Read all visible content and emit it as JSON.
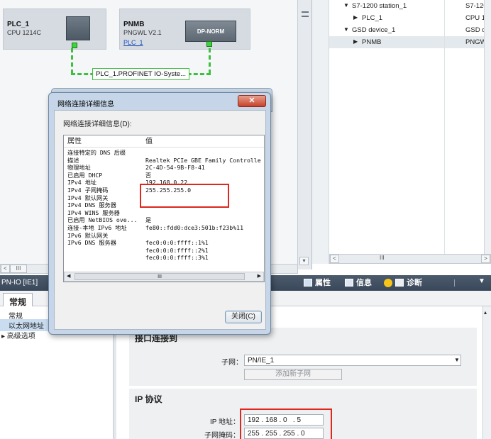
{
  "network_view": {
    "plc1": {
      "name": "PLC_1",
      "type": "CPU 1214C"
    },
    "pnmb": {
      "name": "PNMB",
      "type": "PNGWL V2.1",
      "link": "PLC_1",
      "module_label": "DP-NORM"
    },
    "network_label": "PLC_1.PROFINET IO-Syste..."
  },
  "tree": {
    "rows": [
      {
        "name": "S7-1200 station_1",
        "type": "S7-120..."
      },
      {
        "name": "PLC_1",
        "type": "CPU 12..."
      },
      {
        "name": "GSD device_1",
        "type": "GSD de..."
      },
      {
        "name": "PNMB",
        "type": "PNGWL ..."
      }
    ]
  },
  "scroll": {
    "left_glyph": "<",
    "right_glyph": ">",
    "mid_glyph": "III"
  },
  "properties": {
    "title": "PN-IO [IE1]",
    "tab_attr": "属性",
    "tab_info": "信息",
    "tab_diag": "诊断",
    "main_tab": "常规",
    "nav": [
      "常规",
      "以太网地址",
      "▸ 高级选项"
    ],
    "section_iface": "接口连接到",
    "subnet_label": "子网：",
    "subnet_value": "PN/IE_1",
    "add_subnet": "添加新子网",
    "section_ip": "IP 协议",
    "ip_label": "IP 地址：",
    "ip_value": "192 . 168 . 0   . 5",
    "mask_label": "子网掩码：",
    "mask_value": "255 . 255 . 255 . 0"
  },
  "dialog": {
    "title": "网络连接详细信息",
    "group_label": "网络连接详细信息(D):",
    "col_prop": "属性",
    "col_value": "值",
    "rows": [
      [
        "连接特定的 DNS 后缀",
        ""
      ],
      [
        "描述",
        "Realtek PCIe GBE Family Controlle"
      ],
      [
        "物理地址",
        "2C-4D-54-9B-F8-41"
      ],
      [
        "已启用 DHCP",
        "否"
      ],
      [
        "IPv4 地址",
        "192.168.0.22"
      ],
      [
        "IPv4 子网掩码",
        "255.255.255.0"
      ],
      [
        "IPv4 默认网关",
        ""
      ],
      [
        "IPv4 DNS 服务器",
        ""
      ],
      [
        "IPv4 WINS 服务器",
        ""
      ],
      [
        "已启用 NetBIOS ove...",
        "是"
      ],
      [
        "连接-本地 IPv6 地址",
        "fe80::fdd0:dce3:501b:f23b%11"
      ],
      [
        "IPv6 默认网关",
        ""
      ],
      [
        "IPv6 DNS 服务器",
        "fec0:0:0:ffff::1%1"
      ],
      [
        "",
        "fec0:0:0:ffff::2%1"
      ],
      [
        "",
        "fec0:0:0:ffff::3%1"
      ]
    ],
    "close_label": "关闭(C)",
    "hscroll_mid": "III"
  },
  "colors": {
    "highlight": "#e0261d",
    "network": "#3fbf3f",
    "panel_header": "#3f4e60"
  }
}
